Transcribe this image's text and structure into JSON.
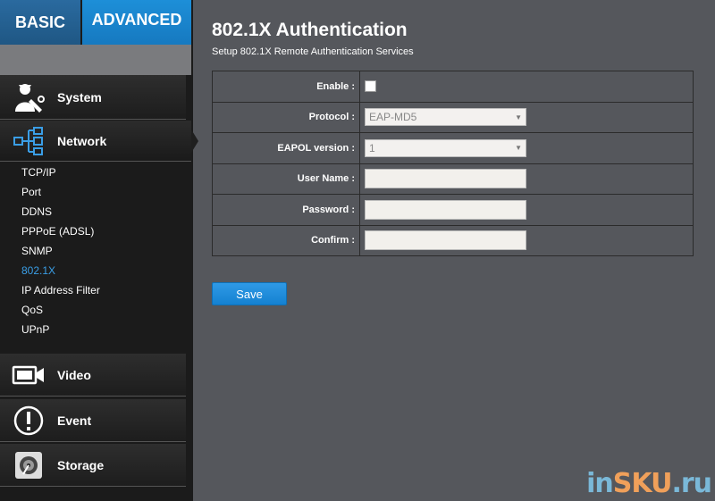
{
  "top_tabs": {
    "basic": "BASIC",
    "advanced": "ADVANCED"
  },
  "sidebar": {
    "main_items": {
      "system": "System",
      "network": "Network",
      "video": "Video",
      "event": "Event",
      "storage": "Storage"
    },
    "network_sub_items": [
      {
        "label": "TCP/IP"
      },
      {
        "label": "Port"
      },
      {
        "label": "DDNS"
      },
      {
        "label": "PPPoE (ADSL)"
      },
      {
        "label": "SNMP"
      },
      {
        "label": "802.1X",
        "active": true
      },
      {
        "label": "IP Address Filter"
      },
      {
        "label": "QoS"
      },
      {
        "label": "UPnP"
      }
    ]
  },
  "page": {
    "title": "802.1X Authentication",
    "subtitle": "Setup 802.1X Remote Authentication Services"
  },
  "form": {
    "enable_label": "Enable :",
    "enable_checked": false,
    "protocol_label": "Protocol :",
    "protocol_value": "EAP-MD5",
    "eapol_label": "EAPOL version :",
    "eapol_value": "1",
    "username_label": "User Name :",
    "username_value": "",
    "password_label": "Password :",
    "password_value": "",
    "confirm_label": "Confirm :",
    "confirm_value": "",
    "save_label": "Save"
  },
  "watermark": {
    "part1": "in",
    "part2": "SKU",
    "part3": ".ru"
  },
  "colors": {
    "accent": "#1679c0",
    "active_link": "#3a9ee6",
    "content_bg": "#55575c",
    "sidebar_bg": "#1b1b1b"
  }
}
